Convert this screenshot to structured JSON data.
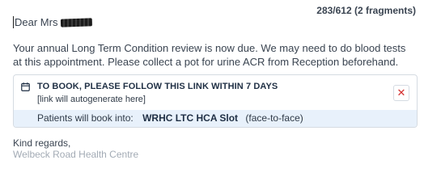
{
  "header": {
    "counter": "283/612 (2 fragments)"
  },
  "message": {
    "greeting": "Dear Mrs",
    "body": "Your annual Long Term Condition review is now due. We may need to do blood tests at this appointment. Please collect a pot for urine ACR from Reception beforehand."
  },
  "booking": {
    "icon": "calendar-icon",
    "title": "TO BOOK, PLEASE FOLLOW THIS LINK WITHIN 7 DAYS",
    "link_placeholder": "[link will autogenerate here]",
    "close_label": "✕",
    "patients_prefix": "Patients will book into:",
    "slot_name": "WRHC LTC HCA Slot",
    "slot_mode": "(face-to-face)"
  },
  "signoff": {
    "regards": "Kind regards,",
    "clinic": "Welbeck Road Health Centre"
  },
  "colors": {
    "close": "#d32f2f",
    "info_bg": "#e8f1fb"
  }
}
